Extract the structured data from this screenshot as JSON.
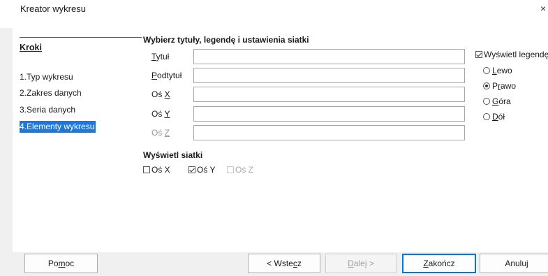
{
  "window": {
    "title": "Kreator wykresu",
    "close_glyph": "×"
  },
  "sidebar": {
    "heading": "Kroki",
    "steps": [
      {
        "label": "1.Typ wykresu",
        "active": false
      },
      {
        "label": "2.Zakres danych",
        "active": false
      },
      {
        "label": "3.Seria danych",
        "active": false
      },
      {
        "label": "4.Elementy wykresu",
        "active": true
      }
    ]
  },
  "titles_section": {
    "heading": "Wybierz tytuły, legendę i ustawienia siatki",
    "fields": [
      {
        "label": "Tytuł",
        "value": "",
        "enabled": true
      },
      {
        "label": "Podtytuł",
        "value": "",
        "enabled": true
      },
      {
        "label": "Oś X",
        "value": "",
        "enabled": true
      },
      {
        "label": "Oś Y",
        "value": "",
        "enabled": true
      },
      {
        "label": "Oś Z",
        "value": "",
        "enabled": false
      }
    ]
  },
  "legend": {
    "show_label": "Wyświetl legendę",
    "show_checked": true,
    "positions": [
      {
        "label": "Lewo",
        "selected": false
      },
      {
        "label": "Prawo",
        "selected": true
      },
      {
        "label": "Góra",
        "selected": false
      },
      {
        "label": "Dół",
        "selected": false
      }
    ]
  },
  "grids": {
    "heading": "Wyświetl siatki",
    "items": [
      {
        "label": "Oś X",
        "checked": false,
        "enabled": true
      },
      {
        "label": "Oś Y",
        "checked": true,
        "enabled": true
      },
      {
        "label": "Oś Z",
        "checked": false,
        "enabled": false
      }
    ]
  },
  "buttons": {
    "help": "Pomoc",
    "back": "< Wstecz",
    "next": "Dalej >",
    "finish": "Zakończ",
    "cancel": "Anuluj"
  }
}
